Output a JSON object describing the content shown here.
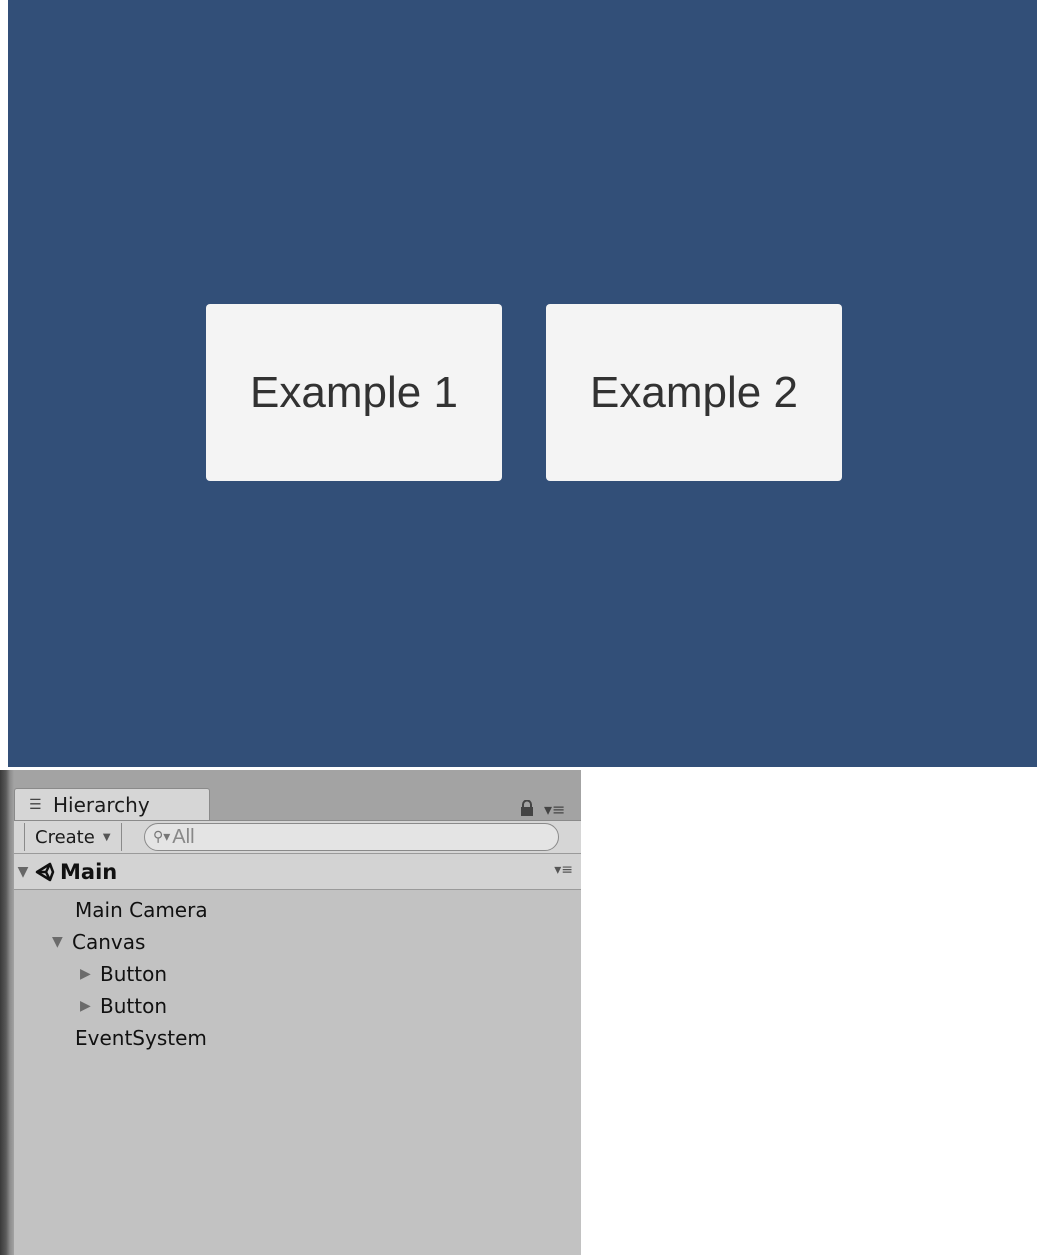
{
  "game_view": {
    "background_color": "#324f78",
    "buttons": [
      {
        "label": "Example 1"
      },
      {
        "label": "Example 2"
      }
    ]
  },
  "hierarchy": {
    "tab_label": "Hierarchy",
    "tab_icon": "list-icon",
    "create_label": "Create",
    "search_placeholder": "All",
    "scene": {
      "name": "Main",
      "icon": "unity-icon",
      "expanded": true
    },
    "items": [
      {
        "label": "Main Camera",
        "expanded": null
      },
      {
        "label": "Canvas",
        "expanded": true
      },
      {
        "label": "Button",
        "expanded": false
      },
      {
        "label": "Button",
        "expanded": false
      },
      {
        "label": "EventSystem",
        "expanded": null
      }
    ]
  }
}
